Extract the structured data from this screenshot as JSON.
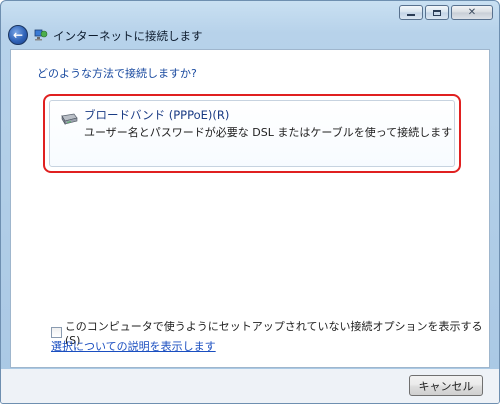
{
  "window": {
    "title": "インターネットに接続します",
    "controls": [
      "minimize-icon",
      "maximize-icon",
      "close-icon"
    ]
  },
  "content": {
    "question": "どのような方法で接続しますか?",
    "option": {
      "title": "ブロードバンド (PPPoE)(R)",
      "description": "ユーザー名とパスワードが必要な DSL またはケーブルを使って接続します",
      "icon": "modem-icon"
    },
    "checkbox": {
      "label": "このコンピュータで使うようにセットアップされていない接続オプションを表示する(S)",
      "checked": false
    },
    "help_link": "選択についての説明を表示します"
  },
  "footer": {
    "cancel_label": "キャンセル"
  },
  "colors": {
    "highlight_border": "#e02020",
    "link": "#1a4ec0",
    "question_text": "#1b4ba0"
  }
}
